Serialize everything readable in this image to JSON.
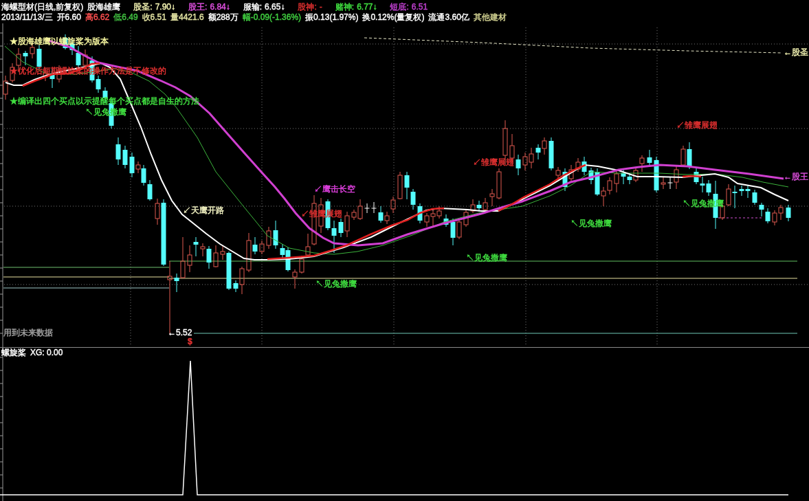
{
  "header": {
    "title": "海螺型材(日线,前复权)",
    "formula": "股海雄鹰",
    "indicators": [
      {
        "label": "股圣:",
        "value": "7.90↓",
        "color": "#f0f0b0"
      },
      {
        "label": "股王:",
        "value": "6.84↓",
        "color": "#e050e0"
      },
      {
        "label": "服输:",
        "value": "6.65↓",
        "color": "#ffffff"
      },
      {
        "label": "股神:",
        "value": "-",
        "color": "#e03030"
      },
      {
        "label": "赌神:",
        "value": "6.77↓",
        "color": "#40e040"
      },
      {
        "label": "短底:",
        "value": "6.51",
        "color": "#c040d0"
      }
    ],
    "quote": [
      {
        "text": "2013/11/13/三",
        "color": "#ffffff"
      },
      {
        "text": "开6.60",
        "color": "#ffffff"
      },
      {
        "text": "高6.62",
        "color": "#ff5050"
      },
      {
        "text": "低6.49",
        "color": "#40c040"
      },
      {
        "text": "收6.51",
        "color": "#e0e0a0"
      },
      {
        "text": "量4421.6",
        "color": "#e0e0a0"
      },
      {
        "text": "额288万",
        "color": "#ffffff"
      },
      {
        "text": "幅-0.09(-1.36%)",
        "color": "#40d040"
      },
      {
        "text": "振0.13(1.97%)",
        "color": "#ffffff"
      },
      {
        "text": "换0.12%(量复权)",
        "color": "#ffffff"
      },
      {
        "text": "流通3.60亿",
        "color": "#ffffff"
      },
      {
        "text": "其他建材",
        "color": "#d0d090"
      }
    ]
  },
  "main_chart": {
    "legend": [
      {
        "text": "★股海雄鹰以螺旋桨为版本",
        "color": "#f8f8a0"
      },
      {
        "text": "★优化后短期螺旋桨的操作方法是不修改的",
        "color": "#e03030"
      },
      {
        "text": "★编译出四个买点以示提醒每个买点都是自生的方法",
        "color": "#40e040"
      }
    ],
    "annotations": [
      {
        "text": "↖见兔撒鹰",
        "color": "#40e040"
      },
      {
        "text": "↙雏鹰展翅",
        "color": "#e03030"
      },
      {
        "text": "↙雏鹰展翅",
        "color": "#e03030"
      },
      {
        "text": "↙鹰击长空",
        "color": "#e040e0"
      },
      {
        "text": "↖见兔撒鹰",
        "color": "#40e040"
      },
      {
        "text": "↙天鹰开路",
        "color": "#f0f0c0"
      },
      {
        "text": "↙雏鹰展翅",
        "color": "#e03030"
      },
      {
        "text": "↖见兔撒鹰",
        "color": "#40e040"
      },
      {
        "text": "↖见兔撒鹰",
        "color": "#40e040"
      },
      {
        "text": "↖见兔撒鹰",
        "color": "#40e040"
      }
    ],
    "price_line_labels": [
      {
        "text": "←股圣",
        "color": "#f0f0b0"
      },
      {
        "text": "←股王",
        "color": "#e050e0"
      }
    ],
    "low_price_label": "←5.52",
    "signal_mark": "$",
    "note": "用到未来数据"
  },
  "sub_chart": {
    "name": "螺旋桨",
    "reading": "XG: 0.00"
  }
}
